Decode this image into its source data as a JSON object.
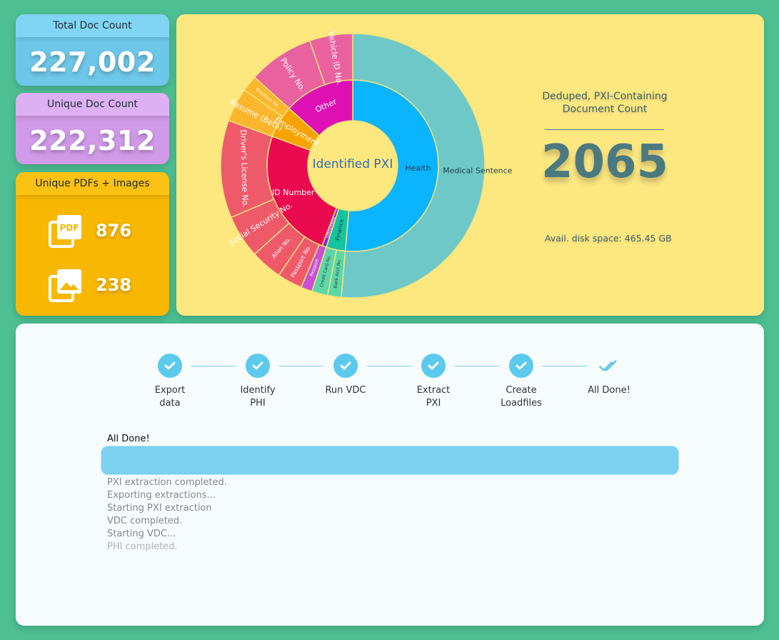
{
  "cards": {
    "total": {
      "label": "Total Doc Count",
      "value": "227,002"
    },
    "unique": {
      "label": "Unique Doc Count",
      "value": "222,312"
    },
    "files": {
      "label": "Unique PDFs + Images",
      "pdf_icon_text": "PDF",
      "pdf_count": "876",
      "image_count": "238"
    }
  },
  "chart_data": {
    "type": "sunburst",
    "center_label": "Identified PXI",
    "segments": [
      {
        "name": "Health",
        "ring": 1,
        "start": -90,
        "end": 95,
        "color": "#0bb4ff",
        "children": [
          {
            "name": "Medical Sentence",
            "start": -90,
            "end": 95,
            "color": "#6ec8c8"
          }
        ]
      },
      {
        "name": "Finance",
        "ring": 1,
        "start": 95,
        "end": 108,
        "color": "#14c3a0",
        "children": [
          {
            "name": "Bank Acct No.",
            "start": 95,
            "end": 101,
            "color": "#5dd7a7"
          },
          {
            "name": "Credit Card No.",
            "start": 101,
            "end": 108,
            "color": "#5dd7a7"
          }
        ]
      },
      {
        "name": "Document",
        "ring": 1,
        "start": 108,
        "end": 111,
        "color": "#8e2bd1",
        "children": [
          {
            "name": "Passport",
            "start": 108,
            "end": 113,
            "color": "#c850d2"
          }
        ]
      },
      {
        "name": "ID Number",
        "ring": 1,
        "start": 111,
        "end": 200,
        "color": "#ea0a4f",
        "children": [
          {
            "name": "Passport No.",
            "start": 113,
            "end": 124,
            "color": "#ee5a6a"
          },
          {
            "name": "Alien No.",
            "start": 124,
            "end": 138,
            "color": "#ee5a6a"
          },
          {
            "name": "Social Security No.",
            "start": 138,
            "end": 157,
            "color": "#ee5a6a"
          },
          {
            "name": "Driver's License No.",
            "start": 157,
            "end": 200,
            "color": "#ee5a6a"
          }
        ]
      },
      {
        "name": "Employment",
        "ring": 1,
        "start": 200,
        "end": 222,
        "color": "#f6a300",
        "children": [
          {
            "name": "Resume (Beta)",
            "start": 200,
            "end": 215,
            "color": "#fbb62e"
          },
          {
            "name": "Employer No.",
            "start": 215,
            "end": 222,
            "color": "#fbb62e"
          }
        ]
      },
      {
        "name": "Other",
        "ring": 1,
        "start": 222,
        "end": 270,
        "color": "#de10b4",
        "children": [
          {
            "name": "Policy No.",
            "start": 222,
            "end": 251,
            "color": "#e9629f"
          },
          {
            "name": "Vehicle ID No.",
            "start": 251,
            "end": 270,
            "color": "#e9629f"
          }
        ]
      }
    ]
  },
  "summary": {
    "title": "Deduped, PXI-Containing Document Count",
    "count": "2065",
    "disk_space": "Avail. disk space: 465.45 GB"
  },
  "progress": {
    "steps": [
      {
        "line1": "Export",
        "line2": "data"
      },
      {
        "line1": "Identify",
        "line2": "PHI"
      },
      {
        "line1": "Run VDC",
        "line2": ""
      },
      {
        "line1": "Extract",
        "line2": "PXI"
      },
      {
        "line1": "Create",
        "line2": "Loadfiles"
      },
      {
        "line1": "All Done!",
        "line2": ""
      }
    ],
    "status": "All Done!",
    "fraction": 1.0,
    "log": [
      "PXI extraction completed.",
      "Exporting extractions...",
      "Starting PXI extraction",
      "VDC completed.",
      "Starting VDC...",
      "PHI completed."
    ]
  }
}
